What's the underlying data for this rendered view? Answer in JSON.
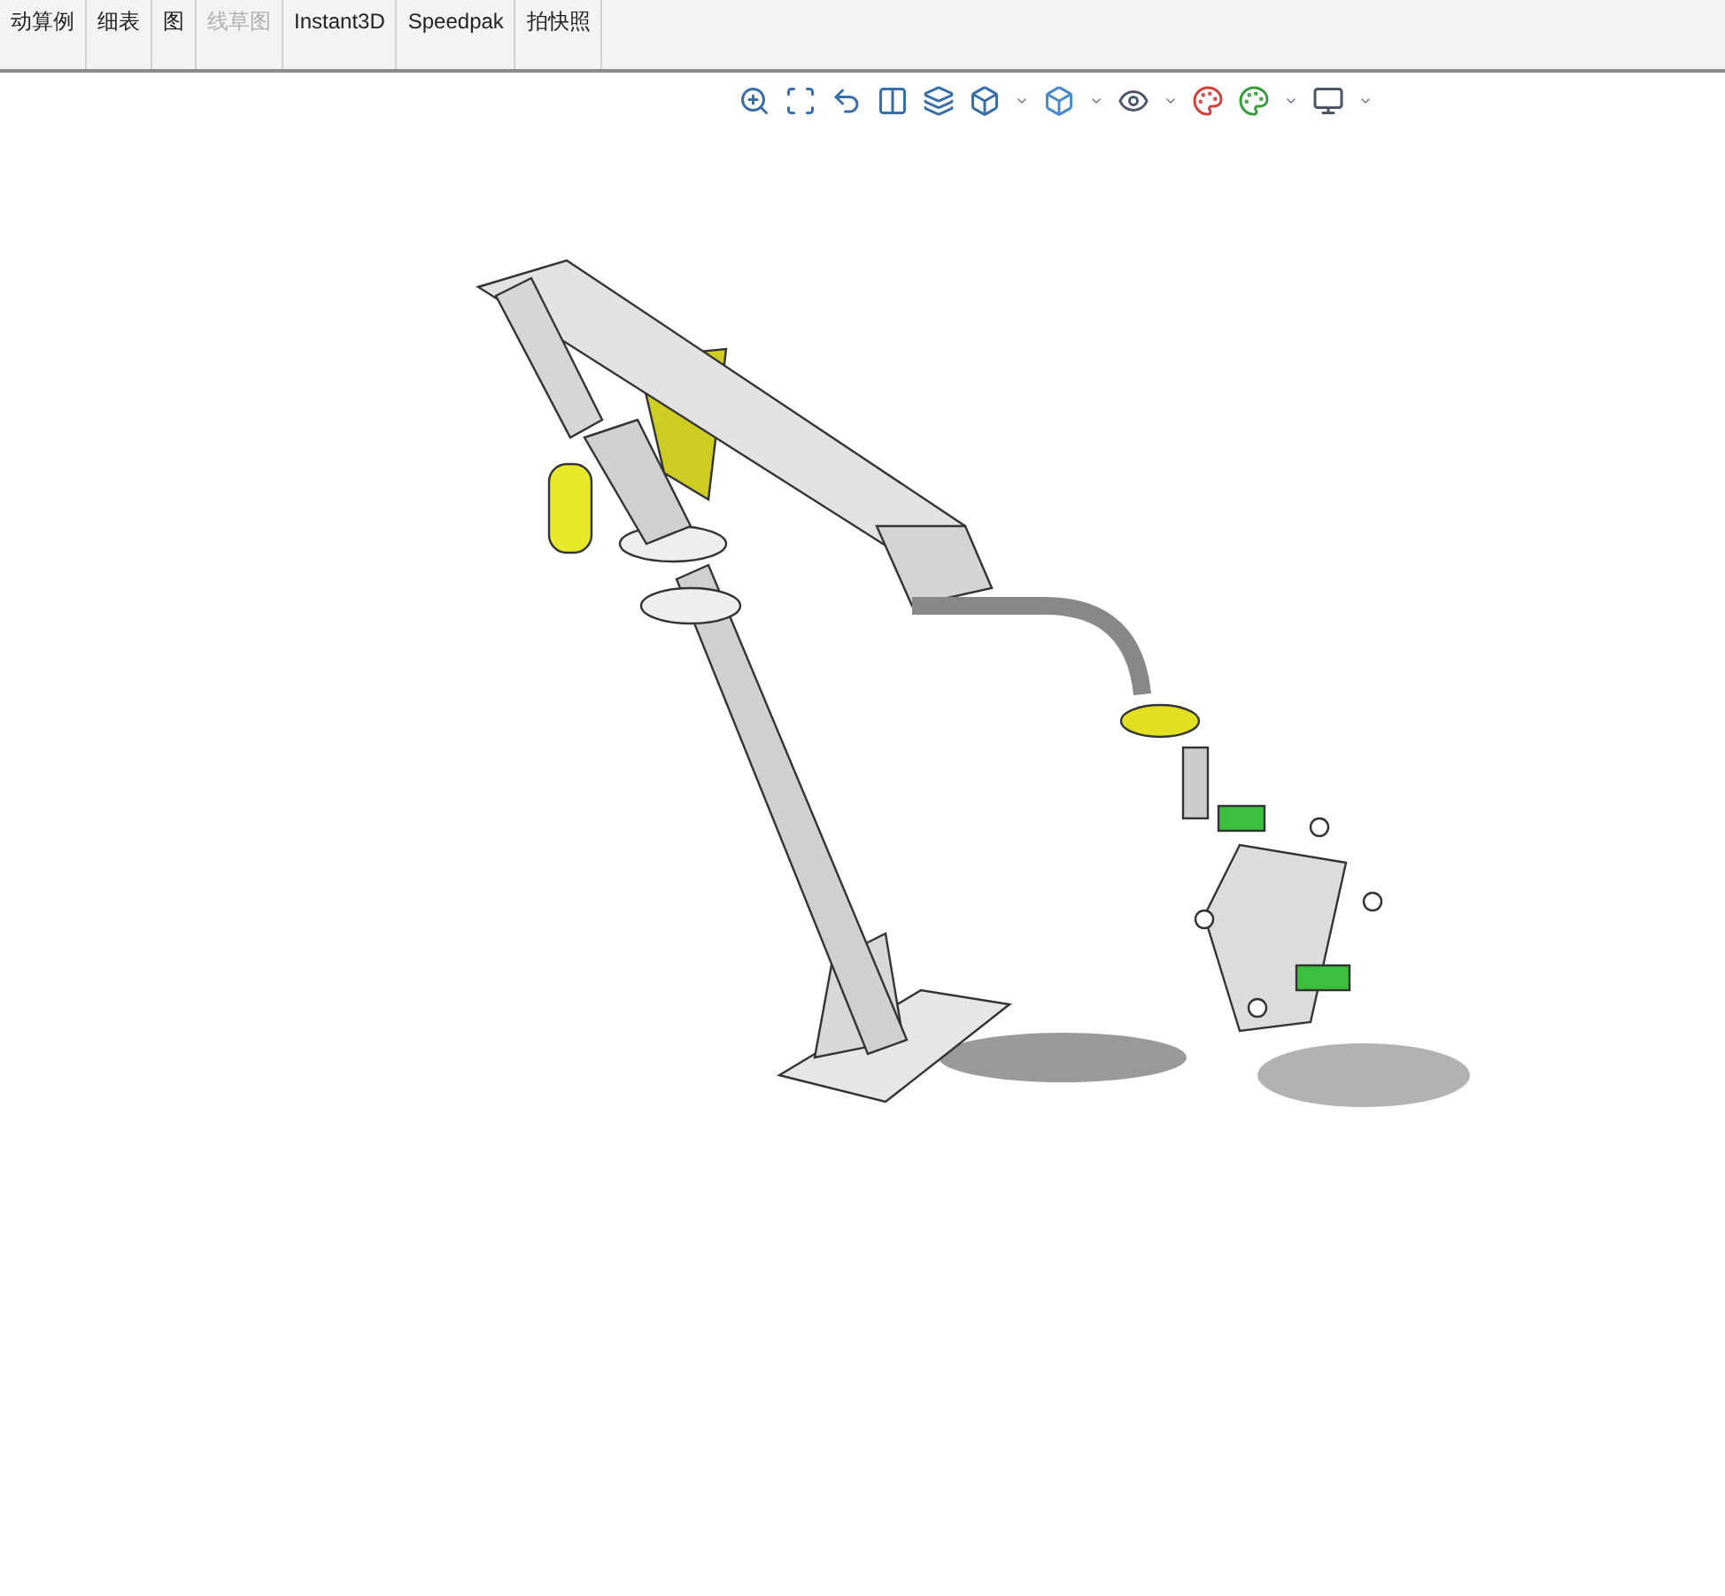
{
  "command_toolbar": {
    "items": [
      {
        "label": "动算例",
        "disabled": false
      },
      {
        "label": "细表",
        "disabled": false
      },
      {
        "label": "图",
        "disabled": false
      },
      {
        "label": "线草图",
        "disabled": true
      },
      {
        "label": "Instant3D",
        "disabled": false
      },
      {
        "label": "Speedpak",
        "disabled": false
      },
      {
        "label": "拍快照",
        "disabled": false
      }
    ]
  }
}
